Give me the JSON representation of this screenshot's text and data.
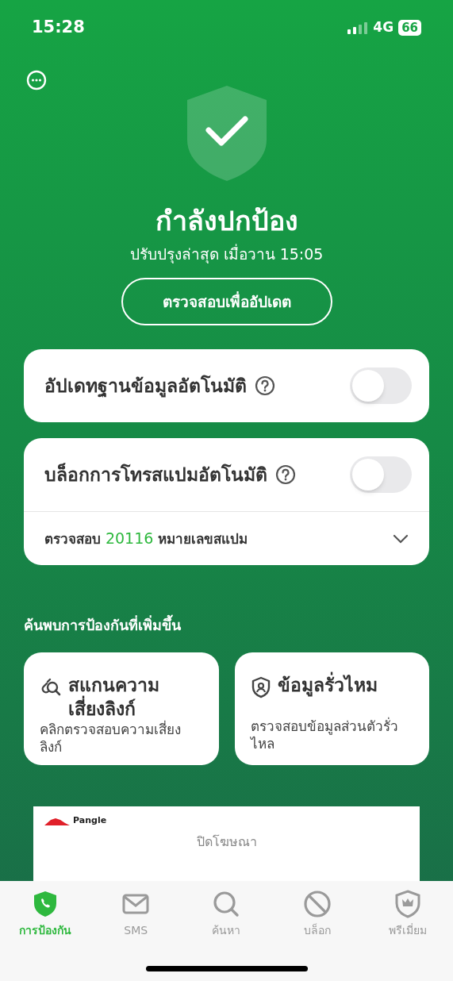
{
  "status_bar": {
    "time": "15:28",
    "network": "4G",
    "battery": "66"
  },
  "hero": {
    "title": "กำลังปกป้อง",
    "subtitle": "ปรับปรุงล่าสุด เมื่อวาน 15:05",
    "button": "ตรวจสอบเพื่ออัปเดต"
  },
  "settings": [
    {
      "label": "อัปเดทฐานข้อมูลอัตโนมัติ",
      "on": false
    },
    {
      "label": "บล็อกการโทรสแปมอัตโนมัติ",
      "on": false,
      "detail": {
        "prefix": "ตรวจสอบ",
        "count": "20116",
        "suffix": "หมายเลขสแปม",
        "expanded": false
      }
    }
  ],
  "section_title": "ค้นพบการป้องกันที่เพิ่มขึ้น",
  "features": [
    {
      "kind": "link",
      "title": "สแกนความเสี่ยงลิงก์",
      "description": "คลิกตรวจสอบความเสี่ยงลิงก์"
    },
    {
      "kind": "leak",
      "title": "ข้อมูลรั่วไหม",
      "description": "ตรวจสอบข้อมูลส่วนตัวรั่วไหล"
    }
  ],
  "ad": {
    "brand": "Pangle",
    "close": "ปิดโฆษณา"
  },
  "tabs": [
    {
      "kind": "protect",
      "label": "การป้องกัน",
      "selected": true
    },
    {
      "kind": "sms",
      "label": "SMS",
      "selected": false
    },
    {
      "kind": "search",
      "label": "ค้นหา",
      "selected": false
    },
    {
      "kind": "block",
      "label": "บล็อก",
      "selected": false
    },
    {
      "kind": "premium",
      "label": "พรีเมี่ยม",
      "selected": false
    }
  ]
}
